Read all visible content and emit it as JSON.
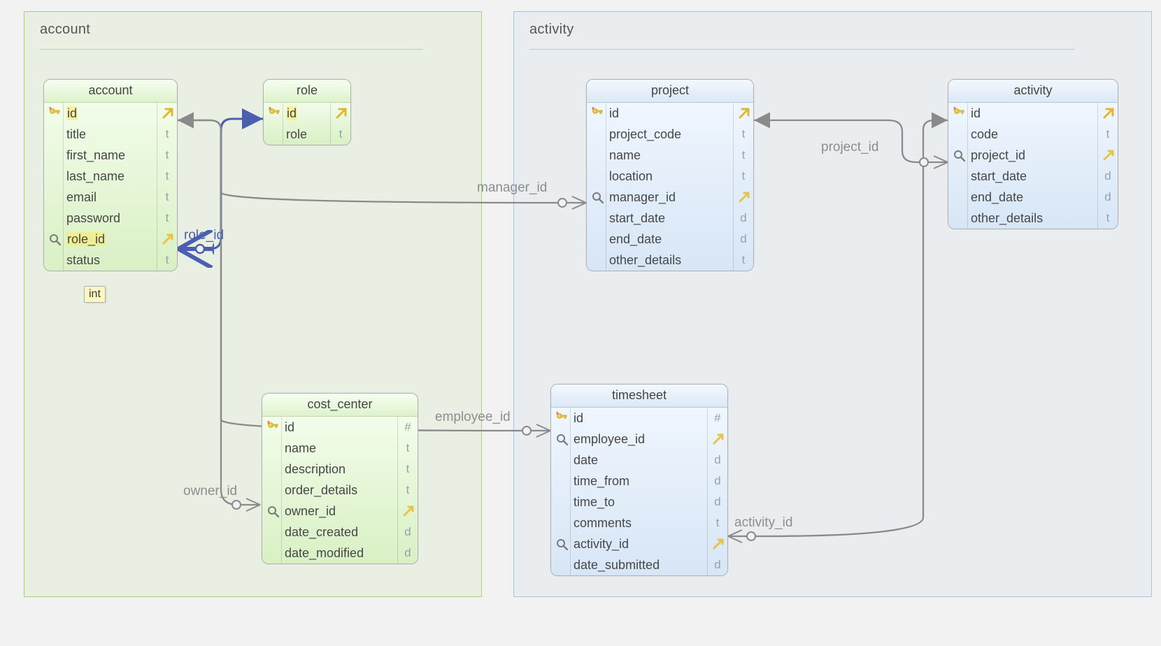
{
  "groups": {
    "account": {
      "title": "account"
    },
    "activity": {
      "title": "activity"
    }
  },
  "tables": {
    "account": {
      "title": "account",
      "fields": [
        {
          "name": "id",
          "pk": true,
          "fk": false,
          "type_icon": "arrow",
          "highlight": true
        },
        {
          "name": "title",
          "pk": false,
          "fk": false,
          "type_icon": "t"
        },
        {
          "name": "first_name",
          "pk": false,
          "fk": false,
          "type_icon": "t"
        },
        {
          "name": "last_name",
          "pk": false,
          "fk": false,
          "type_icon": "t"
        },
        {
          "name": "email",
          "pk": false,
          "fk": false,
          "type_icon": "t"
        },
        {
          "name": "password",
          "pk": false,
          "fk": false,
          "type_icon": "t"
        },
        {
          "name": "role_id",
          "pk": false,
          "fk": true,
          "type_icon": "fkarrow",
          "highlight": true
        },
        {
          "name": "status",
          "pk": false,
          "fk": false,
          "type_icon": "t"
        }
      ]
    },
    "role": {
      "title": "role",
      "fields": [
        {
          "name": "id",
          "pk": true,
          "fk": false,
          "type_icon": "arrow",
          "highlight": true
        },
        {
          "name": "role",
          "pk": false,
          "fk": false,
          "type_icon": "t"
        }
      ]
    },
    "cost_center": {
      "title": "cost_center",
      "fields": [
        {
          "name": "id",
          "pk": true,
          "fk": false,
          "type_icon": "hash"
        },
        {
          "name": "name",
          "pk": false,
          "fk": false,
          "type_icon": "t"
        },
        {
          "name": "description",
          "pk": false,
          "fk": false,
          "type_icon": "t"
        },
        {
          "name": "order_details",
          "pk": false,
          "fk": false,
          "type_icon": "t"
        },
        {
          "name": "owner_id",
          "pk": false,
          "fk": true,
          "type_icon": "fkarrow"
        },
        {
          "name": "date_created",
          "pk": false,
          "fk": false,
          "type_icon": "d"
        },
        {
          "name": "date_modified",
          "pk": false,
          "fk": false,
          "type_icon": "d"
        }
      ]
    },
    "project": {
      "title": "project",
      "fields": [
        {
          "name": "id",
          "pk": true,
          "fk": false,
          "type_icon": "arrow"
        },
        {
          "name": "project_code",
          "pk": false,
          "fk": false,
          "type_icon": "t"
        },
        {
          "name": "name",
          "pk": false,
          "fk": false,
          "type_icon": "t"
        },
        {
          "name": "location",
          "pk": false,
          "fk": false,
          "type_icon": "t"
        },
        {
          "name": "manager_id",
          "pk": false,
          "fk": true,
          "type_icon": "fkarrow"
        },
        {
          "name": "start_date",
          "pk": false,
          "fk": false,
          "type_icon": "d"
        },
        {
          "name": "end_date",
          "pk": false,
          "fk": false,
          "type_icon": "d"
        },
        {
          "name": "other_details",
          "pk": false,
          "fk": false,
          "type_icon": "t"
        }
      ]
    },
    "timesheet": {
      "title": "timesheet",
      "fields": [
        {
          "name": "id",
          "pk": true,
          "fk": false,
          "type_icon": "hash"
        },
        {
          "name": "employee_id",
          "pk": false,
          "fk": true,
          "type_icon": "fkarrow"
        },
        {
          "name": "date",
          "pk": false,
          "fk": false,
          "type_icon": "d"
        },
        {
          "name": "time_from",
          "pk": false,
          "fk": false,
          "type_icon": "d"
        },
        {
          "name": "time_to",
          "pk": false,
          "fk": false,
          "type_icon": "d"
        },
        {
          "name": "comments",
          "pk": false,
          "fk": false,
          "type_icon": "t"
        },
        {
          "name": "activity_id",
          "pk": false,
          "fk": true,
          "type_icon": "fkarrow"
        },
        {
          "name": "date_submitted",
          "pk": false,
          "fk": false,
          "type_icon": "d"
        }
      ]
    },
    "activity": {
      "title": "activity",
      "fields": [
        {
          "name": "id",
          "pk": true,
          "fk": false,
          "type_icon": "arrow"
        },
        {
          "name": "code",
          "pk": false,
          "fk": false,
          "type_icon": "t"
        },
        {
          "name": "project_id",
          "pk": false,
          "fk": true,
          "type_icon": "fkarrow"
        },
        {
          "name": "start_date",
          "pk": false,
          "fk": false,
          "type_icon": "d"
        },
        {
          "name": "end_date",
          "pk": false,
          "fk": false,
          "type_icon": "d"
        },
        {
          "name": "other_details",
          "pk": false,
          "fk": false,
          "type_icon": "t"
        }
      ]
    }
  },
  "relationships": {
    "role_id": {
      "label": "role_id"
    },
    "manager_id": {
      "label": "manager_id"
    },
    "owner_id": {
      "label": "owner_id"
    },
    "employee_id": {
      "label": "employee_id"
    },
    "project_id": {
      "label": "project_id"
    },
    "activity_id": {
      "label": "activity_id"
    }
  },
  "tooltip": {
    "text": "int"
  }
}
